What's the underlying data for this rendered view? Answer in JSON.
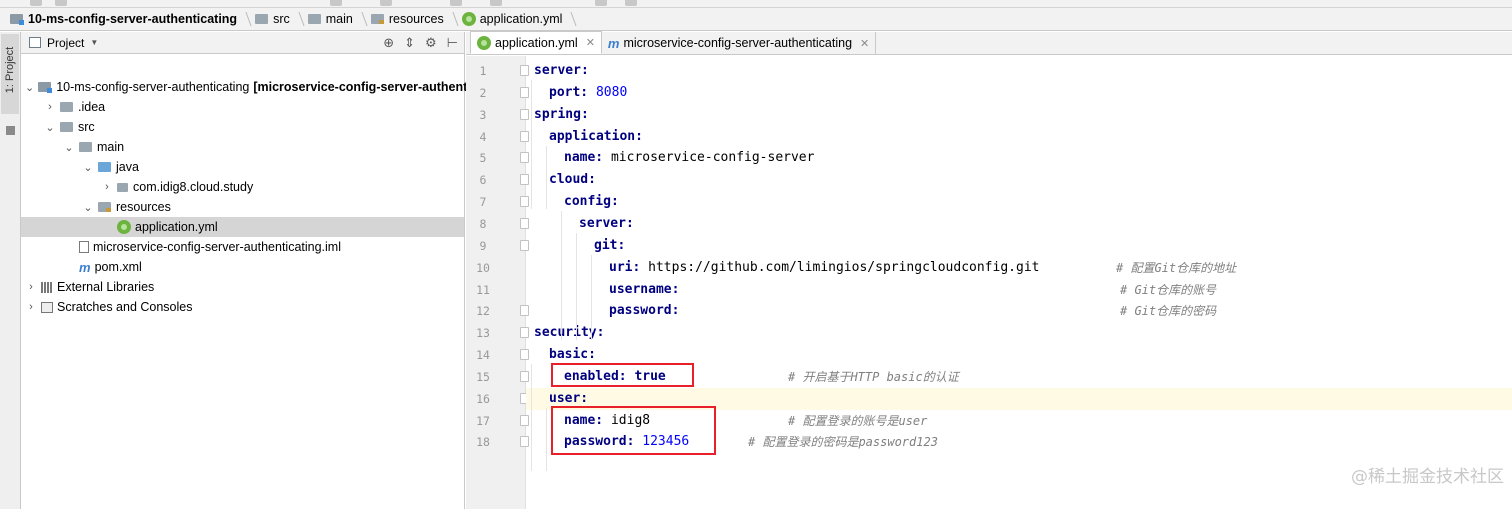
{
  "breadcrumb": {
    "project": "10-ms-config-server-authenticating",
    "items": [
      "src",
      "main",
      "resources",
      "application.yml"
    ]
  },
  "left_strip": {
    "project_tab": "1: Project"
  },
  "project_panel": {
    "title": "Project",
    "tree": [
      {
        "label": "10-ms-config-server-authenticating",
        "suffix": "[microservice-config-server-authent",
        "icon": "module-folder-icon",
        "toggle": "v"
      },
      {
        "label": ".idea",
        "icon": "folder-icon",
        "toggle": ">"
      },
      {
        "label": "src",
        "icon": "folder-icon",
        "toggle": "v"
      },
      {
        "label": "main",
        "icon": "folder-icon",
        "toggle": "v"
      },
      {
        "label": "java",
        "icon": "source-folder-icon",
        "toggle": "v"
      },
      {
        "label": "com.idig8.cloud.study",
        "icon": "package-icon",
        "toggle": ">"
      },
      {
        "label": "resources",
        "icon": "resources-folder-icon",
        "toggle": "v"
      },
      {
        "label": "application.yml",
        "icon": "spring-yml-icon",
        "toggle": ""
      },
      {
        "label": "microservice-config-server-authenticating.iml",
        "icon": "iml-file-icon",
        "toggle": ""
      },
      {
        "label": "pom.xml",
        "icon": "maven-icon",
        "toggle": ""
      },
      {
        "label": "External Libraries",
        "icon": "libraries-icon",
        "toggle": ">"
      },
      {
        "label": "Scratches and Consoles",
        "icon": "scratches-icon",
        "toggle": ">"
      }
    ]
  },
  "editor": {
    "tabs": [
      {
        "label": "application.yml",
        "icon": "spring-yml-icon",
        "active": true
      },
      {
        "label": "microservice-config-server-authenticating",
        "icon": "maven-icon",
        "active": false
      }
    ],
    "line_numbers": [
      "1",
      "2",
      "3",
      "4",
      "5",
      "6",
      "7",
      "8",
      "9",
      "10",
      "11",
      "12",
      "13",
      "14",
      "15",
      "16",
      "17",
      "18"
    ],
    "lines": [
      {
        "key": "server:",
        "val": "",
        "comment": ""
      },
      {
        "key": "port:",
        "val": "8080",
        "comment": ""
      },
      {
        "key": "spring:",
        "val": "",
        "comment": ""
      },
      {
        "key": "application:",
        "val": "",
        "comment": ""
      },
      {
        "key": "name:",
        "val": "microservice-config-server",
        "comment": ""
      },
      {
        "key": "cloud:",
        "val": "",
        "comment": ""
      },
      {
        "key": "config:",
        "val": "",
        "comment": ""
      },
      {
        "key": "server:",
        "val": "",
        "comment": ""
      },
      {
        "key": "git:",
        "val": "",
        "comment": ""
      },
      {
        "key": "uri:",
        "val": "https://github.com/limingios/springcloudconfig.git",
        "comment": "# 配置Git仓库的地址"
      },
      {
        "key": "username:",
        "val": "",
        "comment": "# Git仓库的账号"
      },
      {
        "key": "password:",
        "val": "",
        "comment": "# Git仓库的密码"
      },
      {
        "key": "security:",
        "val": "",
        "comment": ""
      },
      {
        "key": "basic:",
        "val": "",
        "comment": ""
      },
      {
        "key": "enabled:",
        "val": "true",
        "comment": "# 开启基于HTTP basic的认证"
      },
      {
        "key": "user:",
        "val": "",
        "comment": ""
      },
      {
        "key": "name:",
        "val": "idig8",
        "comment": "# 配置登录的账号是user"
      },
      {
        "key": "password:",
        "val": "123456",
        "comment": "# 配置登录的密码是password123"
      }
    ]
  },
  "watermark": "@稀土掘金技术社区",
  "colors": {
    "key": "#000080",
    "number": "#0000ff",
    "comment": "#808080",
    "highlight_box": "#e8202a",
    "current_line": "#fffae3"
  }
}
